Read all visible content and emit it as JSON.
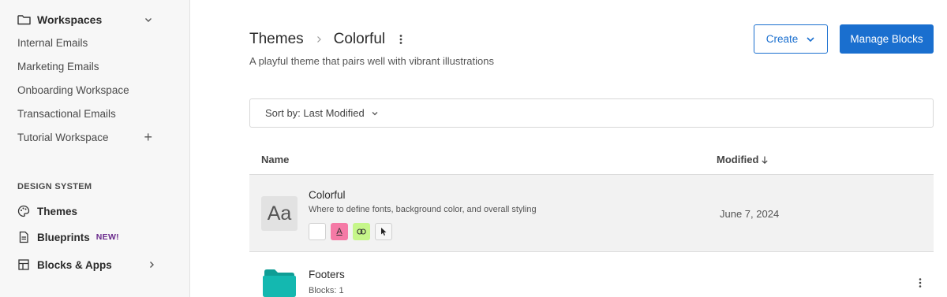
{
  "sidebar": {
    "workspaces_title": "Workspaces",
    "workspace_items": [
      {
        "label": "Internal Emails"
      },
      {
        "label": "Marketing Emails"
      },
      {
        "label": "Onboarding Workspace"
      },
      {
        "label": "Transactional Emails"
      },
      {
        "label": "Tutorial Workspace",
        "add": "+"
      }
    ],
    "design_system_label": "DESIGN SYSTEM",
    "design_items": [
      {
        "label": "Themes",
        "icon": "palette-icon"
      },
      {
        "label": "Blueprints",
        "badge": "NEW!",
        "icon": "document-icon"
      },
      {
        "label": "Blocks & Apps",
        "icon": "grid-icon"
      }
    ]
  },
  "header": {
    "breadcrumb_root": "Themes",
    "breadcrumb_current": "Colorful",
    "subtitle": "A playful theme that pairs well with vibrant illustrations",
    "create_label": "Create",
    "manage_blocks_label": "Manage Blocks"
  },
  "sort": {
    "label": "Sort by: Last Modified"
  },
  "table": {
    "columns": {
      "name": "Name",
      "modified": "Modified"
    },
    "rows": [
      {
        "title": "Colorful",
        "description": "Where to define fonts, background color, and overall styling",
        "thumb_text": "Aa",
        "swatch_text": "A",
        "modified": "June 7, 2024"
      },
      {
        "title": "Footers",
        "subtitle": "Blocks: 1"
      }
    ]
  },
  "colors": {
    "accent": "#1a6fcf",
    "pink_swatch": "#f57aa6",
    "green_swatch": "#c6f68a",
    "folder": "#14b8b0",
    "badge_new": "#6a2a8c"
  }
}
